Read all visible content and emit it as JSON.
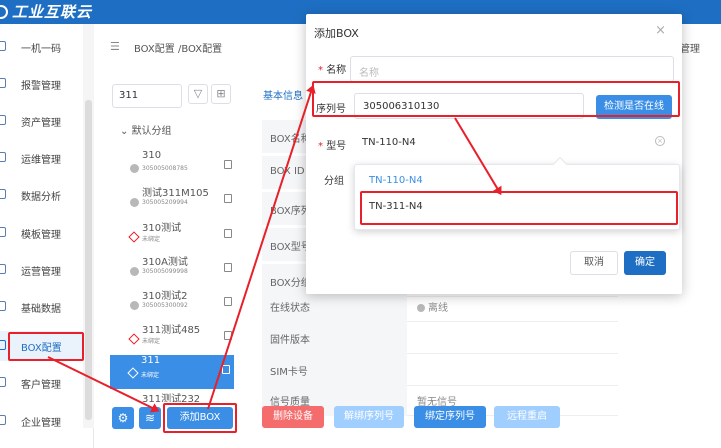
{
  "app": {
    "logo_text": "工业互联云"
  },
  "nav": {
    "items": [
      {
        "label": "一机一码"
      },
      {
        "label": "报警管理"
      },
      {
        "label": "资产管理"
      },
      {
        "label": "运维管理"
      },
      {
        "label": "数据分析"
      },
      {
        "label": "模板管理"
      },
      {
        "label": "运营管理"
      },
      {
        "label": "基础数据"
      },
      {
        "label": "BOX配置"
      },
      {
        "label": "客户管理"
      },
      {
        "label": "企业管理"
      }
    ]
  },
  "breadcrumb": {
    "text": "BOX配置 /BOX配置",
    "menu_glyph": "☰"
  },
  "right_header": {
    "text": "管理"
  },
  "tree": {
    "search_value": "311",
    "group_title": "默认分组",
    "devices": [
      {
        "name": "310",
        "serial": "305005008785"
      },
      {
        "name": "测试311M105",
        "serial": "305005209994"
      },
      {
        "name": "310测试",
        "serial": "未绑定"
      },
      {
        "name": "310A测试",
        "serial": "305005099998"
      },
      {
        "name": "310测试2",
        "serial": "305005300092"
      },
      {
        "name": "311测试485",
        "serial": "未绑定"
      },
      {
        "name": "311",
        "serial": "未绑定"
      },
      {
        "name": "311测试232",
        "serial": ""
      }
    ],
    "add_box_label": "添加BOX"
  },
  "detail": {
    "tab_label": "基本信息",
    "rows": [
      {
        "key": "BOX名称",
        "value": ""
      },
      {
        "key": "BOX ID",
        "value": ""
      },
      {
        "key": "BOX序列号",
        "value": ""
      },
      {
        "key": "BOX型号",
        "value": ""
      },
      {
        "key": "BOX分组",
        "value": ""
      },
      {
        "key": "在线状态",
        "value": "离线"
      },
      {
        "key": "固件版本",
        "value": ""
      },
      {
        "key": "SIM卡号",
        "value": ""
      },
      {
        "key": "信号质量",
        "value": "暂无信号"
      }
    ],
    "actions": {
      "delete": "删除设备",
      "unbind": "解绑序列号",
      "bind": "绑定序列号",
      "restart": "远程重启"
    }
  },
  "modal": {
    "title": "添加BOX",
    "close_glyph": "×",
    "name_label": "名称",
    "name_placeholder": "名称",
    "serial_label": "序列号",
    "serial_value": "305006310130",
    "check_button": "检测是否在线",
    "model_label": "型号",
    "model_value": "TN-110-N4",
    "group_label": "分组",
    "dropdown_options": [
      "TN-110-N4",
      "TN-311-N4"
    ],
    "cancel_label": "取消",
    "ok_label": "确定"
  },
  "colors": {
    "accent": "#3a8ee6",
    "header": "#1e6fc3",
    "danger": "#f56c6c",
    "annotation": "#e8202a"
  }
}
